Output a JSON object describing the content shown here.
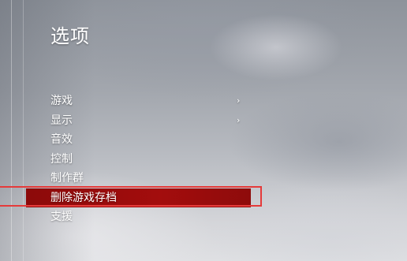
{
  "screen": {
    "title": "选项"
  },
  "menu": {
    "items": [
      {
        "label": "游戏",
        "chevron": "›"
      },
      {
        "label": "显示",
        "chevron": "›"
      },
      {
        "label": "音效",
        "chevron": null
      },
      {
        "label": "控制",
        "chevron": null
      },
      {
        "label": "制作群",
        "chevron": null
      },
      {
        "label": "删除游戏存档",
        "chevron": null,
        "selected": true
      },
      {
        "label": "支援",
        "chevron": null
      }
    ]
  },
  "colors": {
    "selection_fill": "#a30d0d",
    "selection_outline": "#e53a3a",
    "text": "#ffffff"
  },
  "icons": {
    "submenu": "chevron-right-icon"
  }
}
